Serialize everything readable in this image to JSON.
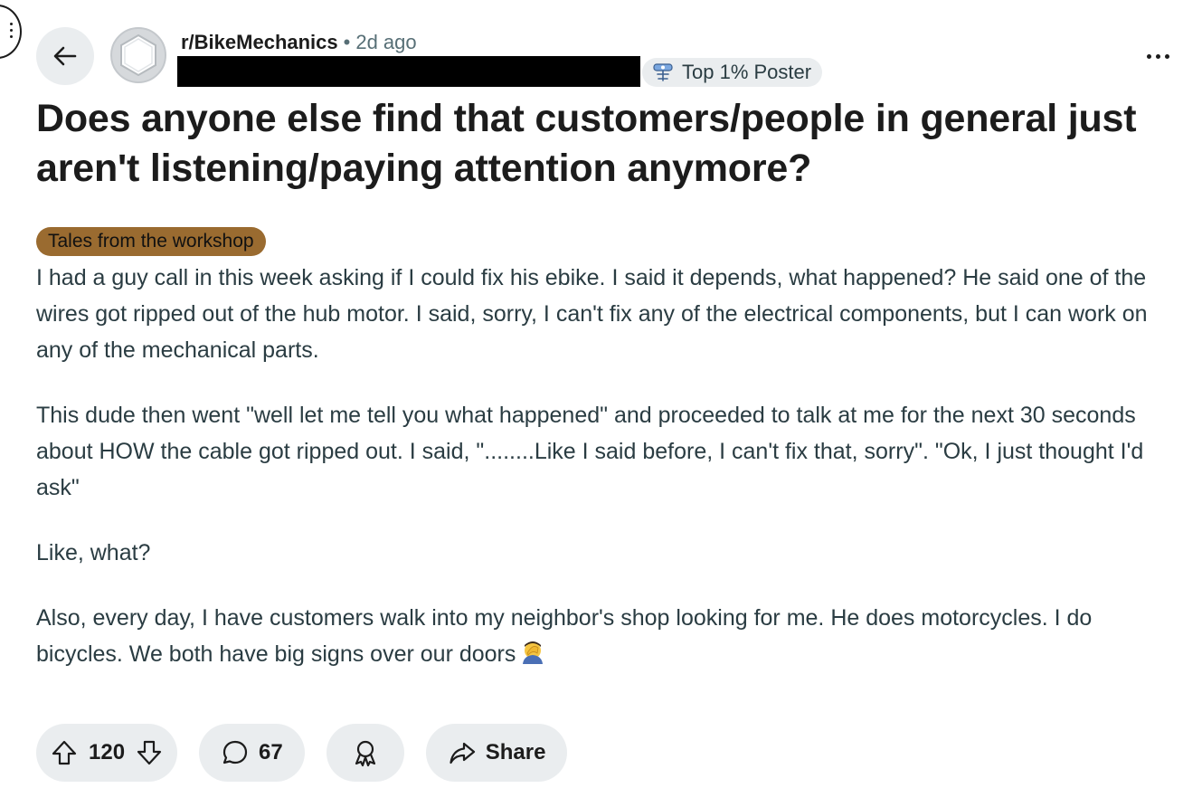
{
  "post": {
    "subreddit": "r/BikeMechanics",
    "separator": "•",
    "time_ago": "2d ago",
    "user_flair": "Top 1% Poster",
    "title": "Does anyone else find that customers/people in general just aren't listening/paying attention anymore?",
    "post_flair": "Tales from the workshop",
    "post_flair_color": "#9a6b30",
    "paragraphs": [
      "I had a guy call in this week asking if I could fix his ebike. I said it depends, what happened? He said one of the wires got ripped out of the hub motor. I said, sorry, I can't fix any of the electrical components, but I can work on any of the mechanical parts.",
      "This dude then went \"well let me tell you what happened\" and proceeded to talk at me for the next 30 seconds about HOW the cable got ripped out. I said, \"........Like I said before, I can't fix that, sorry\". \"Ok, I just thought I'd ask\"",
      "Like, what?",
      "Also, every day, I have customers walk into my neighbor's shop looking for me. He does motorcycles. I do bicycles. We both have big signs over our doors"
    ],
    "emoji": "face-palm-emoji"
  },
  "actions": {
    "upvotes": "120",
    "comments": "67",
    "share_label": "Share"
  },
  "icons": [
    "back-arrow-icon",
    "subreddit-avatar-icon",
    "moderator-badge-icon",
    "more-options-icon",
    "upvote-icon",
    "downvote-icon",
    "comment-icon",
    "award-icon",
    "share-icon"
  ]
}
